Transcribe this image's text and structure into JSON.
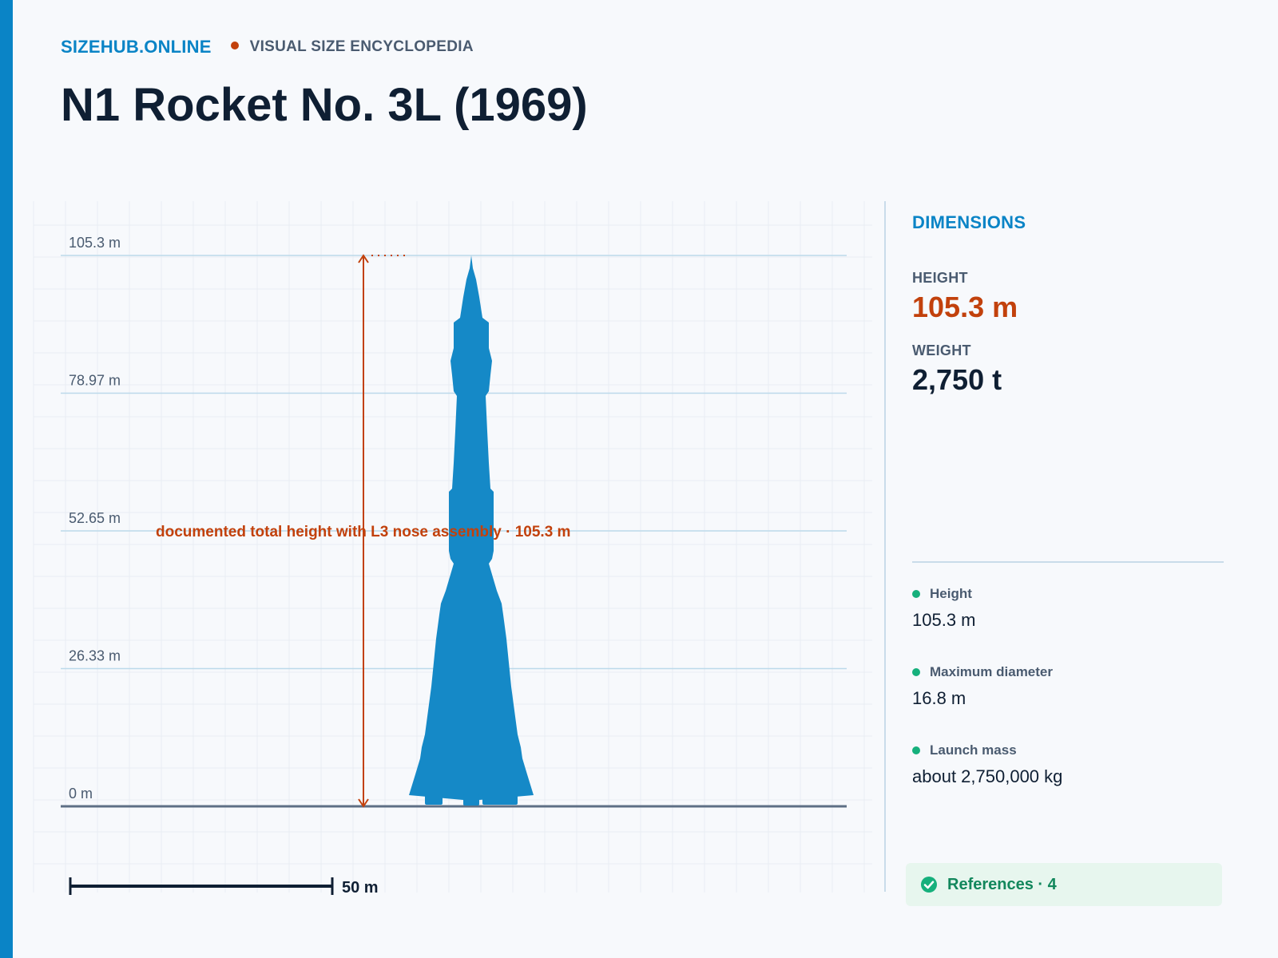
{
  "brand": {
    "name": "SIZEHUB.ONLINE",
    "tagline": "VISUAL SIZE ENCYCLOPEDIA"
  },
  "page": {
    "title": "N1 Rocket No. 3L (1969)"
  },
  "chart_data": {
    "type": "size-comparison",
    "y_unit": "m",
    "y_ticks": [
      {
        "value": 105.3,
        "label": "105.3 m"
      },
      {
        "value": 78.97,
        "label": "78.97 m"
      },
      {
        "value": 52.65,
        "label": "52.65 m"
      },
      {
        "value": 26.33,
        "label": "26.33 m"
      },
      {
        "value": 0,
        "label": "0 m"
      }
    ],
    "ylim": [
      0,
      105.3
    ],
    "object": {
      "name": "N1 Rocket No. 3L",
      "height_m": 105.3,
      "max_diameter_m": 16.8,
      "color": "#1589c7"
    },
    "annotation": {
      "text": "documented total height with L3 nose assembly · 105.3 m",
      "value_m": 105.3,
      "color": "#c2410c"
    },
    "scale_bar": {
      "value_m": 50,
      "label": "50 m"
    }
  },
  "sidebar": {
    "heading": "DIMENSIONS",
    "height_label": "HEIGHT",
    "height_value": "105.3 m",
    "weight_label": "WEIGHT",
    "weight_value": "2,750 t",
    "specs": [
      {
        "label": "Height",
        "value": "105.3 m"
      },
      {
        "label": "Maximum diameter",
        "value": "16.8 m"
      },
      {
        "label": "Launch mass",
        "value": "about 2,750,000 kg"
      }
    ],
    "references_label": "References · 4"
  },
  "colors": {
    "accent": "#0a84c6",
    "highlight": "#c2410c",
    "object": "#1589c7",
    "ok": "#16b07c"
  },
  "icons": {
    "references": "check-circle-icon",
    "brand_separator": "dot-icon"
  }
}
